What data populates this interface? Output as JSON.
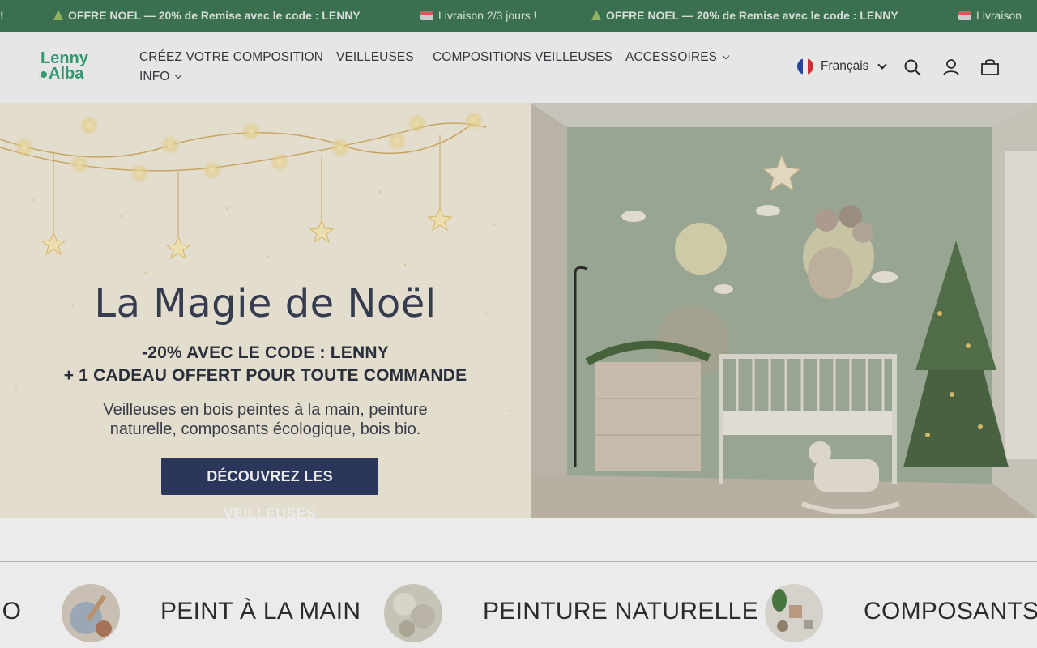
{
  "announcement": {
    "items": [
      {
        "text": "!",
        "type": "tail"
      },
      {
        "text": "OFFRE NOEL — 20% de Remise avec le code : LENNY",
        "icon": "christmas-tree-icon"
      },
      {
        "text": "Livraison 2/3 jours !",
        "icon": "delivery-truck-icon"
      },
      {
        "text": "OFFRE NOEL — 20% de Remise avec le code : LENNY",
        "icon": "christmas-tree-icon"
      },
      {
        "text": "Livraison",
        "icon": "delivery-truck-icon"
      }
    ],
    "background": "#3f7a57"
  },
  "header": {
    "logo": {
      "line1": "Lenny",
      "line2": "Alba",
      "color": "#3aa57a"
    },
    "nav": [
      {
        "label": "CRÉEZ VOTRE COMPOSITION",
        "has_dropdown": false
      },
      {
        "label": "VEILLEUSES",
        "has_dropdown": false
      },
      {
        "label": "COMPOSITIONS VEILLEUSES",
        "has_dropdown": false
      },
      {
        "label": "ACCESSOIRES",
        "has_dropdown": true
      },
      {
        "label": "INFO",
        "has_dropdown": true
      }
    ],
    "language": {
      "label": "Français",
      "flag": "france-flag-icon"
    },
    "icons": [
      "search-icon",
      "account-icon",
      "cart-icon"
    ]
  },
  "hero": {
    "title": "La Magie de Noël",
    "subtitle_line1": "-20% AVEC LE CODE : LENNY",
    "subtitle_line2": "+ 1 CADEAU OFFERT POUR TOUTE COMMANDE",
    "description_line1": "Veilleuses en bois peintes à la main, peinture",
    "description_line2": "naturelle, composants écologique, bois bio.",
    "cta_label": "DÉCOUVREZ LES VEILLEUSES",
    "cta_color": "#2f3b63"
  },
  "values_band": {
    "items": [
      {
        "text": "IO",
        "image": "partial"
      },
      {
        "text": "PEINT À LA MAIN",
        "image": "painting-hand-image"
      },
      {
        "text": "PEINTURE NATURELLE",
        "image": "paint-stones-image"
      },
      {
        "text": "COMPOSANTS É",
        "image": "eco-components-image"
      }
    ]
  }
}
